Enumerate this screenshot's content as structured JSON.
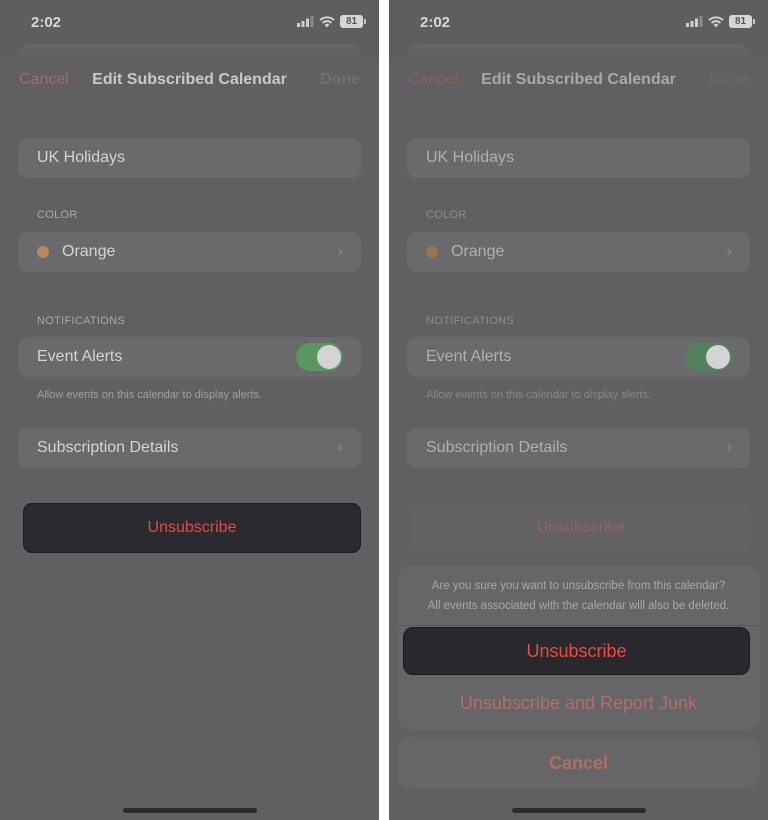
{
  "status": {
    "time": "2:02",
    "battery": "81"
  },
  "nav": {
    "cancel_label": "Cancel",
    "title": "Edit Subscribed Calendar",
    "done_label": "Done"
  },
  "calendar": {
    "name": "UK Holidays"
  },
  "color_section": {
    "label": "COLOR",
    "value": "Orange",
    "dot_color": "#b3895d"
  },
  "notifications_section": {
    "label": "NOTIFICATIONS",
    "event_alerts_label": "Event Alerts",
    "event_alerts_on": true,
    "footnote": "Allow events on this calendar to display alerts."
  },
  "subscription_details_label": "Subscription Details",
  "unsubscribe_label": "Unsubscribe",
  "action_sheet": {
    "message_line1": "Are you sure you want to unsubscribe from this calendar?",
    "message_line2": "All events associated with the calendar will also be deleted.",
    "unsubscribe_label": "Unsubscribe",
    "report_junk_label": "Unsubscribe and Report Junk",
    "cancel_label": "Cancel"
  },
  "colors": {
    "destructive": "#e24b42",
    "toggle_on": "#5b9560"
  }
}
